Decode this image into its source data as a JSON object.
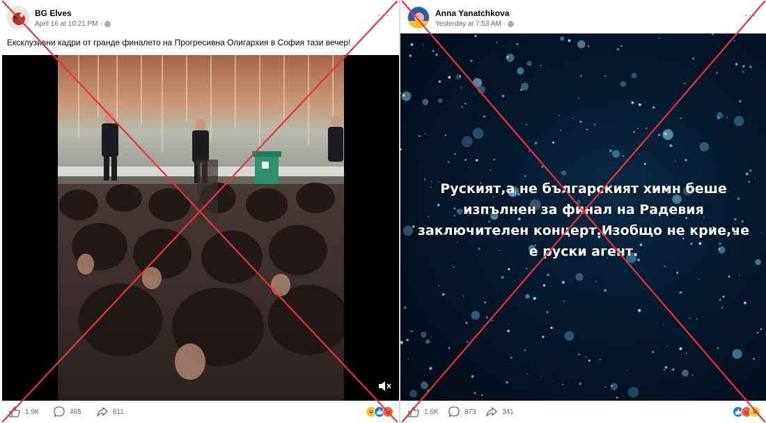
{
  "left_post": {
    "author": "BG Elves",
    "timestamp": "April 16 at 10:21 PM",
    "privacy_icon": "globe-icon",
    "caption": "Ексклузивни кадри от гранде финалето на Прогресивна Олигархия в София тази вечер!",
    "reactions": {
      "likes": "1.9K",
      "comments": "465",
      "shares": "611"
    },
    "reaction_icons": [
      "haha",
      "like",
      "angry"
    ]
  },
  "right_post": {
    "author": "Anna Yanatchkova",
    "timestamp": "Yesterday at 7:53 AM",
    "privacy_icon": "globe-icon",
    "image_text": "Руският,а не българският химн беше изпълнен за финал на Радевия заключителен концерт.Изобщо не крие,че е руски агент.",
    "reactions": {
      "likes": "1.6K",
      "comments": "873",
      "shares": "341"
    },
    "reaction_icons": [
      "like",
      "angry",
      "haha"
    ]
  },
  "colors": {
    "cross": "#e8333a",
    "meta_text": "#65676b",
    "like_blue": "#1877f2",
    "angry_orange": "#f0623c",
    "haha_yellow": "#f7c533",
    "stage_green": "#2d8f6f"
  }
}
